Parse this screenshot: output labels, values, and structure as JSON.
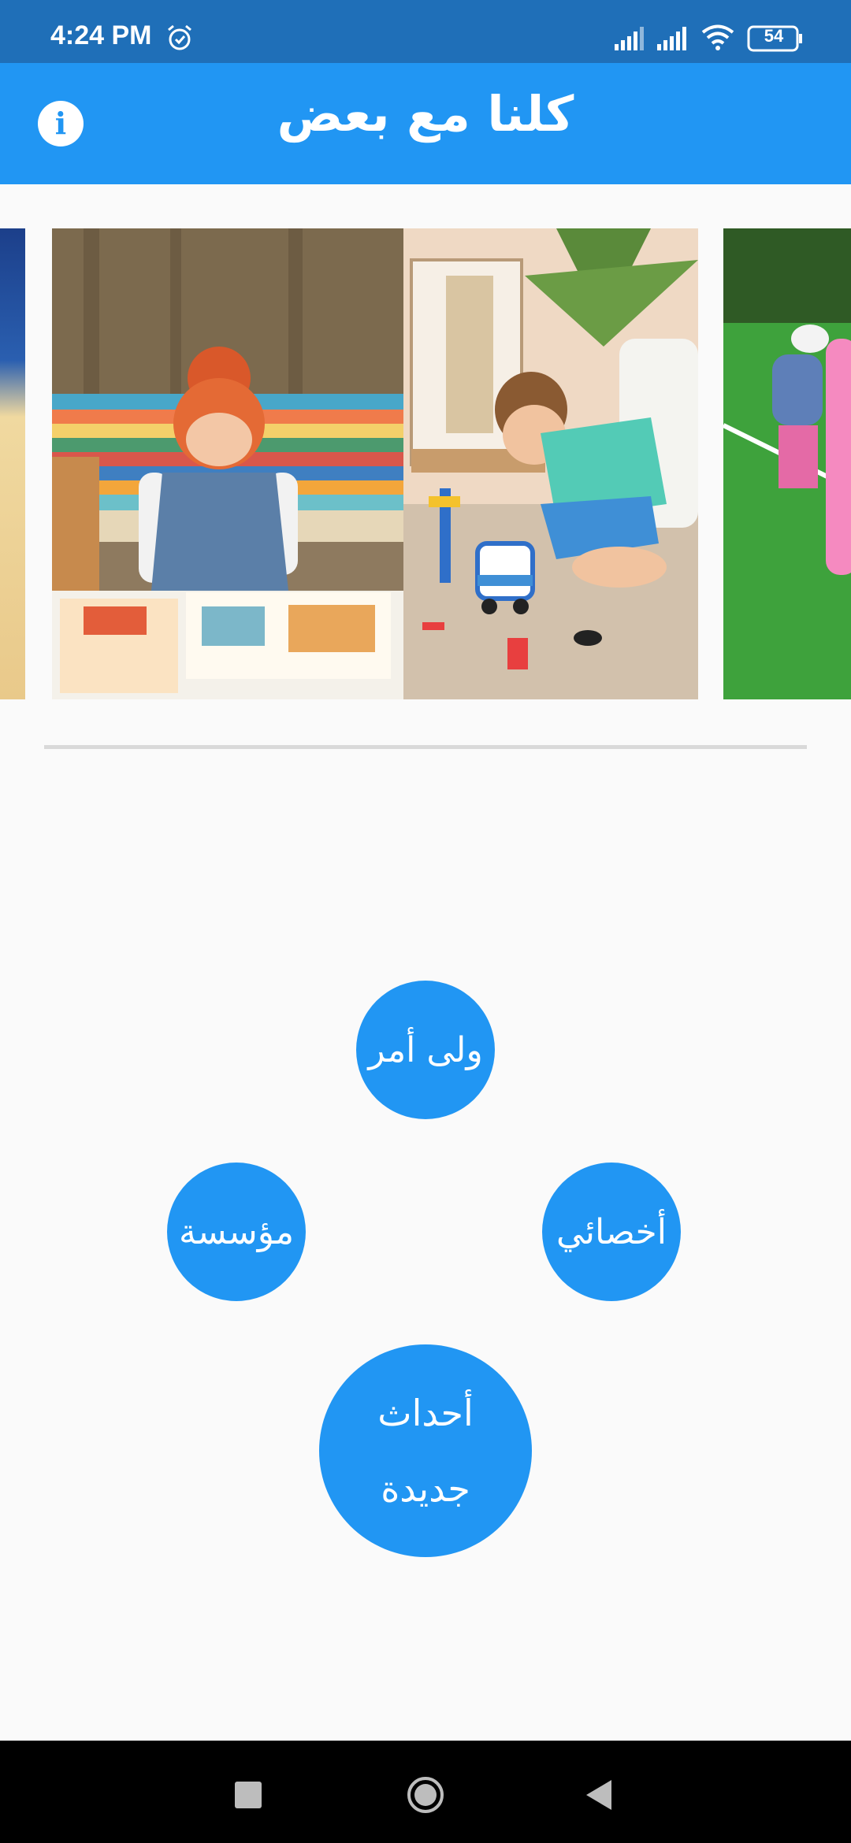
{
  "status_bar": {
    "time": "4:24 PM",
    "battery": "54",
    "icons": [
      "alarm-icon",
      "signal-icon",
      "signal-icon",
      "wifi-icon",
      "battery-icon"
    ]
  },
  "app_bar": {
    "title": "كلنا مع بعض",
    "info_icon": "info-icon",
    "info_glyph": "i",
    "background": "#2196f3"
  },
  "carousel": {
    "slides": [
      "photo-partial-left",
      "photo-children-playing",
      "photo-partial-right"
    ]
  },
  "menu": {
    "guardian": "ولى أمر",
    "institution": "مؤسسة",
    "specialist": "أخصائي",
    "events_line1": "أحداث",
    "events_line2": "جديدة",
    "button_color": "#2196f3"
  },
  "nav_bar": {
    "icons": [
      "recents-icon",
      "home-icon",
      "back-icon"
    ]
  }
}
